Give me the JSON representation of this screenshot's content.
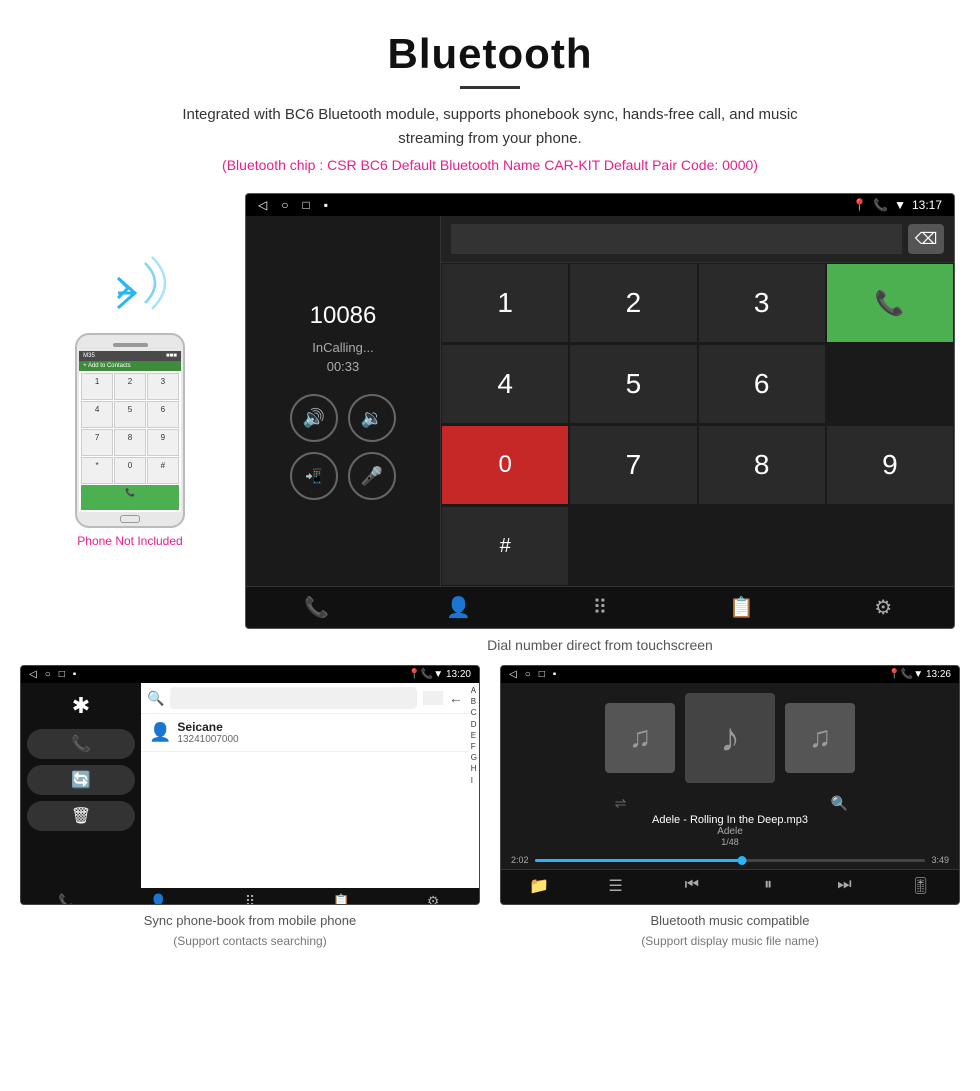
{
  "header": {
    "title": "Bluetooth",
    "subtitle": "Integrated with BC6 Bluetooth module, supports phonebook sync, hands-free call, and music streaming from your phone.",
    "specs": "(Bluetooth chip : CSR BC6    Default Bluetooth Name CAR-KIT    Default Pair Code: 0000)"
  },
  "phone_label": "Phone Not Included",
  "main_screen": {
    "status_left": [
      "◁",
      "○",
      "□",
      "▪"
    ],
    "status_right": "13:17",
    "dialer_number": "10086",
    "dialer_status": "InCalling...",
    "dialer_timer": "00:33",
    "caption": "Dial number direct from touchscreen"
  },
  "phonebook_screen": {
    "status_left": [
      "◁",
      "○",
      "□",
      "▪"
    ],
    "status_right": "13:20",
    "contact_name": "Seicane",
    "contact_number": "13241007000",
    "letters": [
      "A",
      "B",
      "C",
      "D",
      "E",
      "F",
      "G",
      "H",
      "I"
    ],
    "caption_line1": "Sync phone-book from mobile phone",
    "caption_line2": "(Support contacts searching)"
  },
  "music_screen": {
    "status_left": [
      "◁",
      "○",
      "□",
      "▪"
    ],
    "status_right": "13:26",
    "song_title": "Adele - Rolling In the Deep.mp3",
    "artist": "Adele",
    "track_info": "1/48",
    "time_current": "2:02",
    "time_total": "3:49",
    "caption_line1": "Bluetooth music compatible",
    "caption_line2": "(Support display music file name)"
  },
  "numpad": {
    "keys": [
      "1",
      "2",
      "3",
      "*",
      "4",
      "5",
      "6",
      "0",
      "7",
      "8",
      "9",
      "#"
    ]
  }
}
